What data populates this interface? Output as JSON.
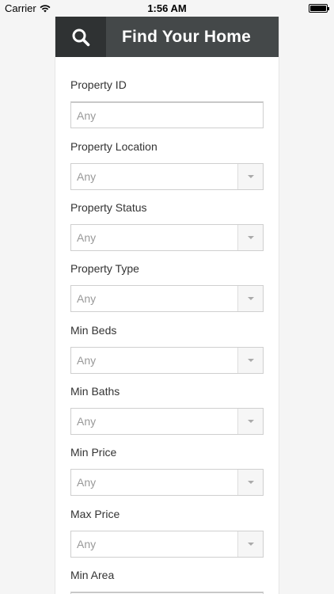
{
  "status_bar": {
    "carrier": "Carrier",
    "time": "1:56 AM"
  },
  "header": {
    "title": "Find Your Home",
    "search_icon": "search-icon"
  },
  "fields": [
    {
      "label": "Property ID",
      "value": "Any",
      "kind": "text"
    },
    {
      "label": "Property Location",
      "value": "Any",
      "kind": "select"
    },
    {
      "label": "Property Status",
      "value": "Any",
      "kind": "select"
    },
    {
      "label": "Property Type",
      "value": "Any",
      "kind": "select"
    },
    {
      "label": "Min Beds",
      "value": "Any",
      "kind": "select"
    },
    {
      "label": "Min Baths",
      "value": "Any",
      "kind": "select"
    },
    {
      "label": "Min Price",
      "value": "Any",
      "kind": "select"
    },
    {
      "label": "Max Price",
      "value": "Any",
      "kind": "select"
    },
    {
      "label": "Min Area",
      "value": "",
      "kind": "text"
    }
  ],
  "colors": {
    "header_bg": "#444849",
    "search_bg": "#2f3233",
    "placeholder": "#999999"
  }
}
